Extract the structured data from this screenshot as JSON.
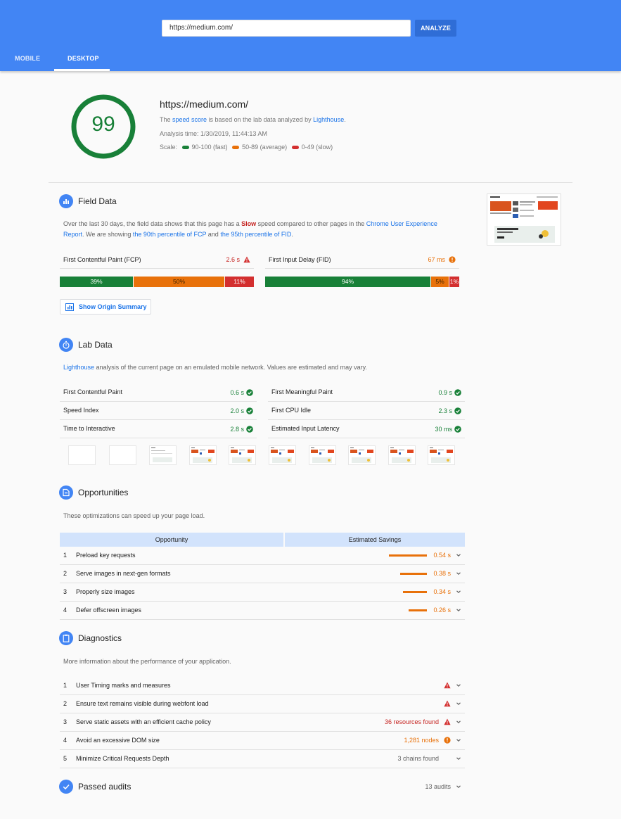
{
  "header": {
    "url_value": "https://medium.com/",
    "analyze_label": "ANALYZE",
    "tabs": [
      {
        "label": "MOBILE"
      },
      {
        "label": "DESKTOP"
      }
    ]
  },
  "summary": {
    "score": "99",
    "url": "https://medium.com/",
    "desc_pre": "The ",
    "desc_link1": "speed score",
    "desc_mid": " is based on the lab data analyzed by ",
    "desc_link2": "Lighthouse",
    "desc_post": ".",
    "analysis_time": "Analysis time: 1/30/2019, 11:44:13 AM",
    "scale_label": "Scale:",
    "scale_fast": "90-100 (fast)",
    "scale_avg": "50-89 (average)",
    "scale_slow": "0-49 (slow)",
    "colors": {
      "fast": "#188038",
      "average": "#e8710a",
      "slow": "#d32f2f"
    }
  },
  "field": {
    "title": "Field Data",
    "p1": "Over the last 30 days, the field data shows that this page has a ",
    "slow": "Slow",
    "p2": " speed compared to other pages in the ",
    "link1": "Chrome User Experience",
    "link1b": "Report",
    "p3": ". We are showing ",
    "link2": "the 90th percentile of FCP",
    "p4": " and ",
    "link3": "the 95th percentile of FID",
    "p5": ".",
    "fcp_label": "First Contentful Paint (FCP)",
    "fcp_value": "2.6 s",
    "fid_label": "First Input Delay (FID)",
    "fid_value": "67 ms",
    "fcp_dist": [
      "39%",
      "50%",
      "11%"
    ],
    "fid_dist": [
      "94%",
      "5%",
      "1%"
    ],
    "origin_button": "Show Origin Summary"
  },
  "lab": {
    "title": "Lab Data",
    "link": "Lighthouse",
    "desc": " analysis of the current page on an emulated mobile network. Values are estimated and may vary.",
    "metrics": [
      {
        "label": "First Contentful Paint",
        "value": "0.6 s"
      },
      {
        "label": "First Meaningful Paint",
        "value": "0.9 s"
      },
      {
        "label": "Speed Index",
        "value": "2.0 s"
      },
      {
        "label": "First CPU Idle",
        "value": "2.3 s"
      },
      {
        "label": "Time to Interactive",
        "value": "2.8 s"
      },
      {
        "label": "Estimated Input Latency",
        "value": "30 ms"
      }
    ]
  },
  "opportunities": {
    "title": "Opportunities",
    "desc": "These optimizations can speed up your page load.",
    "col1": "Opportunity",
    "col2": "Estimated Savings",
    "items": [
      {
        "num": "1",
        "label": "Preload key requests",
        "value": "0.54 s"
      },
      {
        "num": "2",
        "label": "Serve images in next-gen formats",
        "value": "0.38 s"
      },
      {
        "num": "3",
        "label": "Properly size images",
        "value": "0.34 s"
      },
      {
        "num": "4",
        "label": "Defer offscreen images",
        "value": "0.26 s"
      }
    ]
  },
  "diagnostics": {
    "title": "Diagnostics",
    "desc": "More information about the performance of your application.",
    "items": [
      {
        "num": "1",
        "label": "User Timing marks and measures",
        "value": ""
      },
      {
        "num": "2",
        "label": "Ensure text remains visible during webfont load",
        "value": ""
      },
      {
        "num": "3",
        "label": "Serve static assets with an efficient cache policy",
        "value": "36 resources found"
      },
      {
        "num": "4",
        "label": "Avoid an excessive DOM size",
        "value": "1,281 nodes"
      },
      {
        "num": "5",
        "label": "Minimize Critical Requests Depth",
        "value": "3 chains found"
      }
    ]
  },
  "passed": {
    "title": "Passed audits",
    "count": "13 audits"
  }
}
